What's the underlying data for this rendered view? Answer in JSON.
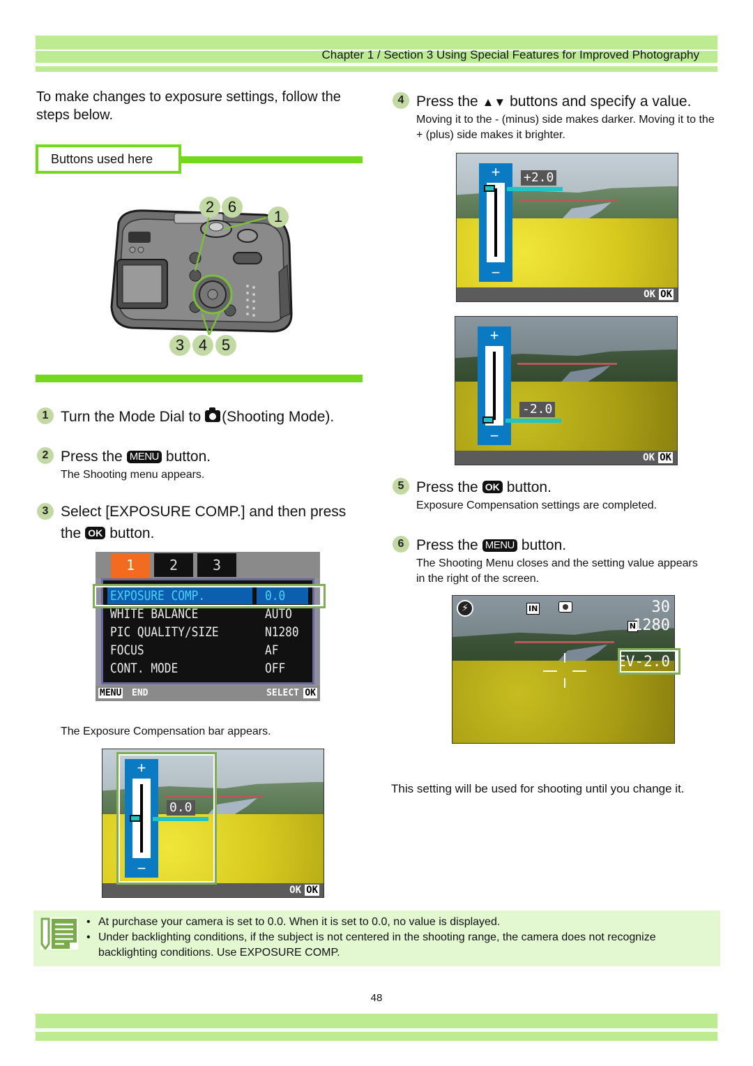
{
  "header": {
    "title": "Chapter 1 / Section 3  Using Special Features for Improved Photography",
    "band_color": "#bdeb91"
  },
  "intro": "To make changes to exposure settings, follow the steps below.",
  "buttons_used": {
    "label": "Buttons used here",
    "accent_color": "#74d81c"
  },
  "camera_callouts": {
    "top_left": [
      "2",
      "6"
    ],
    "top_right": "1",
    "bottom": [
      "3",
      "4",
      "5"
    ]
  },
  "steps": [
    {
      "num": "1",
      "before": "Turn the Mode Dial to",
      "icon": "camera-icon",
      "after": "(Shooting Mode).",
      "sub": ""
    },
    {
      "num": "2",
      "before": "Press the",
      "key": "MENU",
      "after": "button.",
      "sub": "The Shooting menu appears."
    },
    {
      "num": "3",
      "line1": "Select  [EXPOSURE COMP.] and then press",
      "before": "the",
      "key": "OK",
      "after": "button.",
      "sub": "The Exposure Compensation bar appears."
    },
    {
      "num": "4",
      "before": "Press the",
      "key_glyph": "▲▼",
      "after": "buttons and specify a value.",
      "sub": "Moving it to the - (minus) side makes darker. Moving it to the + (plus) side makes it brighter."
    },
    {
      "num": "5",
      "before": "Press the",
      "key": "OK",
      "after": "button.",
      "sub": "Exposure Compensation settings are completed."
    },
    {
      "num": "6",
      "before": "Press the",
      "key": "MENU",
      "after": "button.",
      "sub": "The Shooting Menu closes and the setting value appears in the right of the screen."
    }
  ],
  "menu_screen": {
    "tabs": [
      "1",
      "2",
      "3"
    ],
    "active_tab": "1",
    "rows": [
      {
        "label": "EXPOSURE COMP.",
        "value": "0.0",
        "selected": true
      },
      {
        "label": "WHITE BALANCE",
        "value": "AUTO"
      },
      {
        "label": "PIC QUALITY/SIZE",
        "value": "N1280"
      },
      {
        "label": "FOCUS",
        "value": "AF"
      },
      {
        "label": "CONT. MODE",
        "value": "OFF"
      }
    ],
    "footer_left_key": "MENU",
    "footer_left": "END",
    "footer_right": "SELECT",
    "footer_right_key": "OK"
  },
  "ev_screens": [
    {
      "value": "0.0",
      "level": 0.0,
      "plus": "+",
      "minus": "−",
      "ok_label": "OK",
      "ok_key": "OK"
    },
    {
      "value": "+2.0",
      "level": 2.0,
      "plus": "+",
      "minus": "−",
      "ok_label": "OK",
      "ok_key": "OK"
    },
    {
      "value": "-2.0",
      "level": -2.0,
      "plus": "+",
      "minus": "−",
      "ok_label": "OK",
      "ok_key": "OK"
    }
  ],
  "ev_range": [
    -2.0,
    2.0
  ],
  "live_view": {
    "icons": [
      "flash-off-icon",
      "internal-memory-icon",
      "shooting-mode-icon"
    ],
    "memory_label": "IN",
    "shots_remaining": "30",
    "quality_badge": "N",
    "size": "1280",
    "ev": "EV-2.0"
  },
  "closing_note": "This setting will be used for shooting until you change it.",
  "notes": [
    "At purchase your camera is set to 0.0. When it is set to 0.0, no value is displayed.",
    "Under backlighting conditions, if the subject is not centered in the shooting range, the camera does not recognize backlighting conditions. Use EXPOSURE COMP."
  ],
  "page_number": "48"
}
